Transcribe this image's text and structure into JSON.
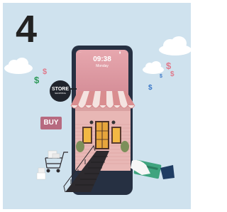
{
  "illustration": {
    "number": "4",
    "phone": {
      "time": "09:38",
      "date": "Monday",
      "status_left": "∙∙∙",
      "status_right": "▮"
    },
    "store_sign": {
      "line1": "STORE",
      "line2": "SHOPPING"
    },
    "buy_tag": "BUY",
    "money_symbols": [
      "$",
      "$",
      "$",
      "$",
      "$",
      "$"
    ],
    "colors": {
      "background": "#cfe2ee",
      "store": "#e8b7b5",
      "awning": "#d98d8f",
      "phone": "#263042",
      "card": "#3fa47f"
    }
  }
}
